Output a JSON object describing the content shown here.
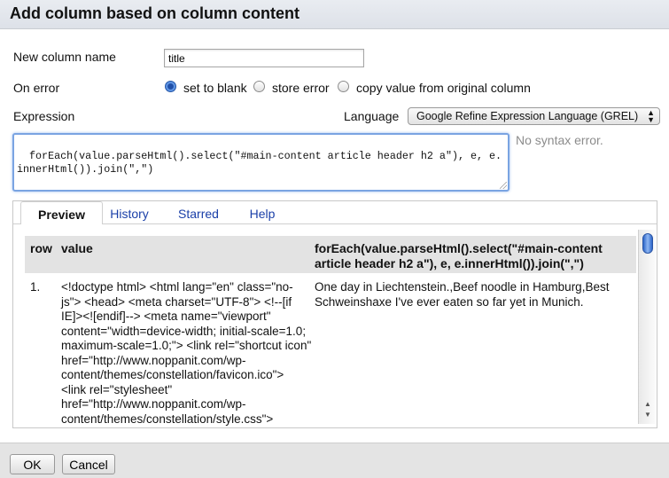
{
  "dialog": {
    "title": "Add column based on column content"
  },
  "form": {
    "new_column_label": "New column name",
    "new_column_value": "title",
    "on_error_label": "On error",
    "on_error_options": [
      "set to blank",
      "store error",
      "copy value from original column"
    ],
    "on_error_selected": "set to blank",
    "expression_label": "Expression",
    "language_label": "Language",
    "language_value": "Google Refine Expression Language (GREL)",
    "expression_value": "forEach(value.parseHtml().select(\"#main-content article header h2 a\"), e, e.innerHtml()).join(\",\")",
    "syntax_status": "No syntax error."
  },
  "tabs": [
    "Preview",
    "History",
    "Starred",
    "Help"
  ],
  "active_tab": "Preview",
  "preview": {
    "columns": [
      "row",
      "value",
      "forEach(value.parseHtml().select(\"#main-content article header h2 a\"), e, e.innerHtml()).join(\",\")"
    ],
    "rows": [
      {
        "row": "1.",
        "value": "<!doctype html> <html lang=\"en\" class=\"no-js\"> <head> <meta charset=\"UTF-8\"> <!--[if IE]><![endif]--> <meta name=\"viewport\" content=\"width=device-width; initial-scale=1.0; maximum-scale=1.0;\"> <link rel=\"shortcut icon\" href=\"http://www.noppanit.com/wp-content/themes/constellation/favicon.ico\"> <link rel=\"stylesheet\" href=\"http://www.noppanit.com/wp-content/themes/constellation/style.css\">",
        "result": "One day in Liechtenstein.,Beef noodle in Hamburg,Best Schweinshaxe I've ever eaten so far yet in Munich."
      }
    ]
  },
  "buttons": {
    "ok": "OK",
    "cancel": "Cancel"
  }
}
